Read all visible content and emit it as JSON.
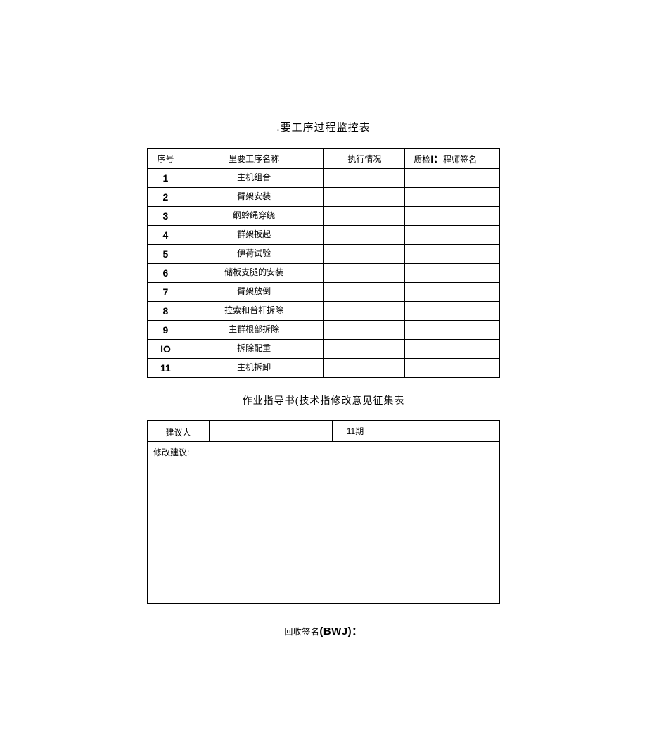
{
  "table1": {
    "title": ".要工序过程监控表",
    "headers": {
      "seq": "序号",
      "name": "里要工序名称",
      "exec": "执行情况",
      "sign_prefix": "质检",
      "sign_i": "I：",
      "sign_suffix": "程师签名"
    },
    "rows": [
      {
        "num": "1",
        "name": "主机组合"
      },
      {
        "num": "2",
        "name": "臂架安装"
      },
      {
        "num": "3",
        "name": "纲蛉绳穿绕"
      },
      {
        "num": "4",
        "name": "群架扳起"
      },
      {
        "num": "5",
        "name": "伊荷试验"
      },
      {
        "num": "6",
        "name": "储板支腿的安装"
      },
      {
        "num": "7",
        "name": "臂架放倒"
      },
      {
        "num": "8",
        "name": "拉索和普杆拆除"
      },
      {
        "num": "9",
        "name": "主群根部拆除"
      },
      {
        "num": "IO",
        "name": "拆除配重"
      },
      {
        "num": "11",
        "name": "主机拆卸"
      }
    ]
  },
  "table2": {
    "title": "作业指导书(技术指修改意见征集表",
    "headers": {
      "suggester": "建议人",
      "period": "11期"
    },
    "content_label": "修改建议:"
  },
  "signature": {
    "prefix": "回收签名",
    "bwj": "(BWJ)：",
    "suffix": ""
  }
}
